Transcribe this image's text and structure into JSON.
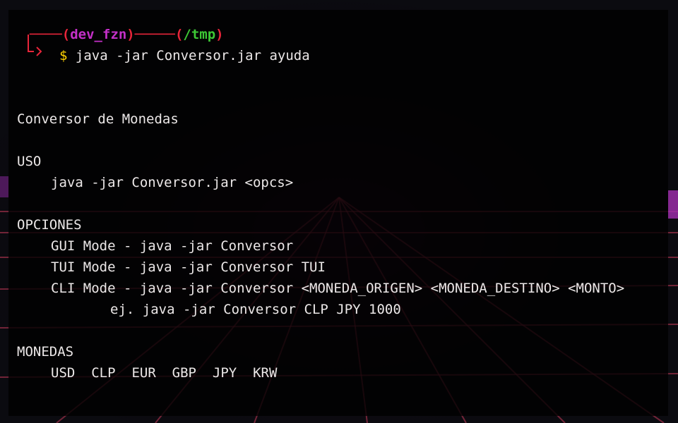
{
  "prompt": {
    "user": "dev_fzn",
    "cwd": "/tmp",
    "symbol": "$",
    "command": "java -jar Conversor.jar ayuda"
  },
  "output": {
    "title": "Conversor de Monedas",
    "uso_header": "USO",
    "uso_line": "java -jar Conversor.jar <opcs>",
    "opciones_header": "OPCIONES",
    "gui_mode": "GUI Mode - java -jar Conversor",
    "tui_mode": "TUI Mode - java -jar Conversor TUI",
    "cli_mode": "CLI Mode - java -jar Conversor <MONEDA_ORIGEN> <MONEDA_DESTINO> <MONTO>",
    "cli_example": "ej. java -jar Conversor CLP JPY 1000",
    "monedas_header": "MONEDAS",
    "currencies": [
      "USD",
      "CLP",
      "EUR",
      "GBP",
      "JPY",
      "KRW"
    ]
  },
  "colors": {
    "user": "#c430c8",
    "cwd": "#3dc935",
    "bracket": "#e8253a",
    "dollar": "#ffd200",
    "text": "#ece8e8",
    "grid": "#e0506a"
  }
}
